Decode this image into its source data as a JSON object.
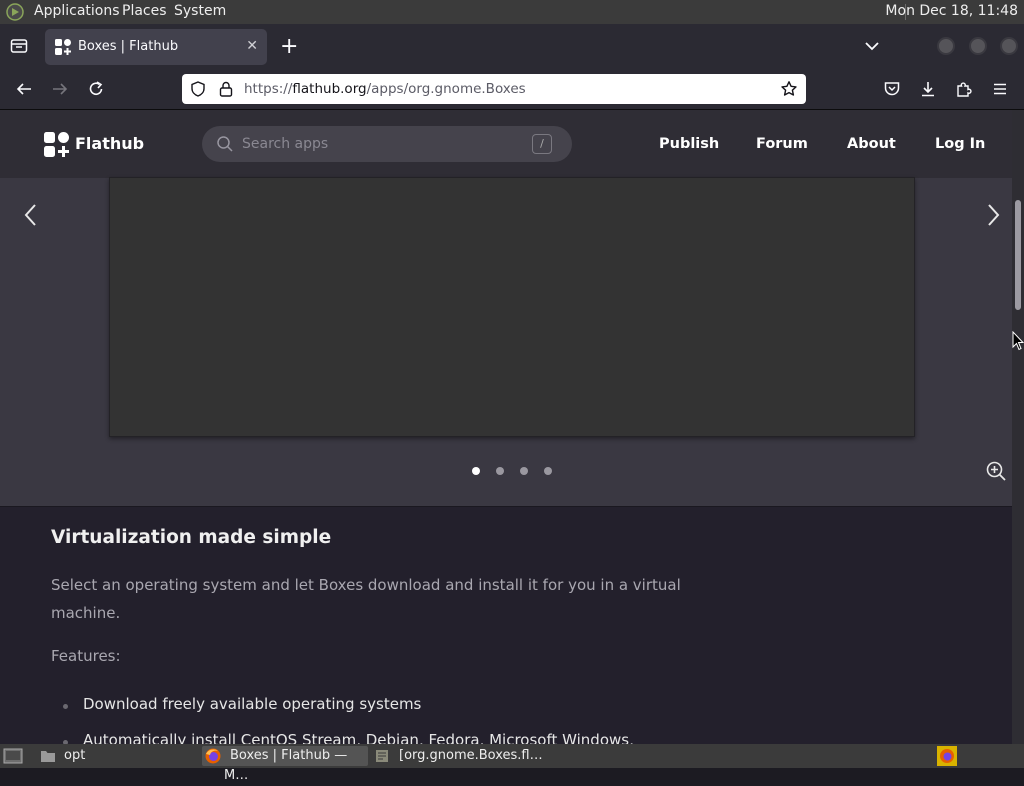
{
  "panel": {
    "applications": "Applications",
    "places": "Places",
    "system": "System",
    "clock": "Mon Dec 18, 11:48"
  },
  "browser": {
    "tab_title": "Boxes | Flathub",
    "url_host": "flathub.org",
    "url_scheme": "https://",
    "url_path": "/apps/org.gnome.Boxes"
  },
  "site": {
    "logo": "Flathub",
    "search_placeholder": "Search apps",
    "search_shortcut": "/",
    "nav": {
      "publish": "Publish",
      "forum": "Forum",
      "about": "About",
      "login": "Log In"
    },
    "carousel": {
      "slide_count": 4,
      "active_slide": 1
    }
  },
  "description": {
    "heading": "Virtualization made simple",
    "paragraph": "Select an operating system and let Boxes download and install it for you in a virtual machine.",
    "features_label": "Features:",
    "features": [
      "Download freely available operating systems",
      "Automatically install CentOS Stream, Debian, Fedora, Microsoft Windows,"
    ]
  },
  "taskbar": {
    "items": [
      "opt",
      "Boxes | Flathub — M…",
      "[org.gnome.Boxes.fl…"
    ]
  },
  "colors": {
    "accent": "#4a90d9",
    "page_bg": "#3a3842",
    "desc_bg": "#23202c"
  }
}
